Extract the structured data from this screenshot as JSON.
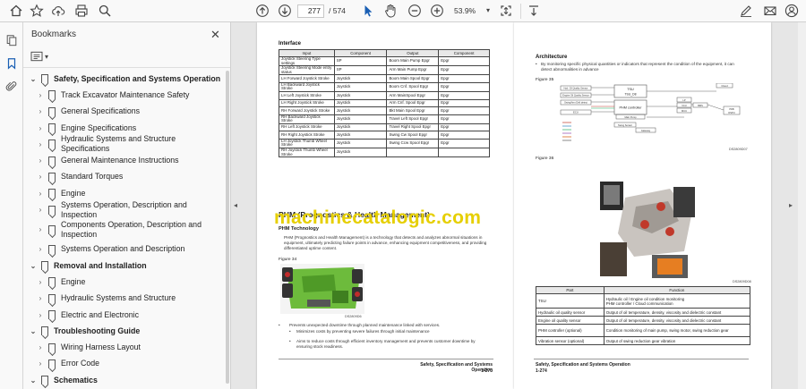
{
  "toolbar": {
    "current_page": "277",
    "total_pages": "/ 574",
    "zoom": "53.9%"
  },
  "bookmarks_panel": {
    "title": "Bookmarks",
    "items": [
      {
        "label": "Safety, Specification and Systems Operation",
        "level": 0,
        "expanded": true
      },
      {
        "label": "Track Excavator Maintenance Safety",
        "level": 1
      },
      {
        "label": "General Specifications",
        "level": 1
      },
      {
        "label": "Engine Specifications",
        "level": 1
      },
      {
        "label": "Hydraulic Systems and Structure Specifications",
        "level": 1
      },
      {
        "label": "General Maintenance Instructions",
        "level": 1
      },
      {
        "label": "Standard Torques",
        "level": 1
      },
      {
        "label": "Engine",
        "level": 1
      },
      {
        "label": "Systems Operation, Description and Inspection",
        "level": 1
      },
      {
        "label": "Components Operation, Description and Inspection",
        "level": 1,
        "two_line": true
      },
      {
        "label": "Systems Operation and Description",
        "level": 1
      },
      {
        "label": "Removal and Installation",
        "level": 0,
        "expanded": true
      },
      {
        "label": "Engine",
        "level": 1
      },
      {
        "label": "Hydraulic Systems and Structure",
        "level": 1
      },
      {
        "label": "Electric and Electronic",
        "level": 1
      },
      {
        "label": "Troubleshooting Guide",
        "level": 0,
        "expanded": true
      },
      {
        "label": "Wiring Harness Layout",
        "level": 1
      },
      {
        "label": "Error Code",
        "level": 1
      },
      {
        "label": "Schematics",
        "level": 0,
        "expanded": true
      }
    ]
  },
  "left_page": {
    "section": "Interface",
    "table_headers": [
      "Input",
      "Component",
      "Output",
      "Component"
    ],
    "table_rows": [
      [
        "Joystick Steering Type settings",
        "SP",
        "Boom Main Pump Epgr",
        "Epgr"
      ],
      [
        "Joystick Steering Mode entry status",
        "SP",
        "Arm Main Pump Epgr",
        "Epgr"
      ],
      [
        "LH Forward Joystick Stroke",
        "Joystick",
        "Boom Main Spool Epgr",
        "Epgr"
      ],
      [
        "LH Backward Joystick Stroke",
        "Joystick",
        "Boom Cnf. Spool Epgr",
        "Epgr"
      ],
      [
        "LH Left Joystick Stroke",
        "Joystick",
        "Arm MainSpool Epgr",
        "Epgr"
      ],
      [
        "LH Right Joystick Stroke",
        "Joystick",
        "Arm Cnf. Spool Epgr",
        "Epgr"
      ],
      [
        "RH Forward Joystick Stroke",
        "Joystick",
        "Bkt Main Spool Epgr",
        "Epgr"
      ],
      [
        "RH Backward Joystick Stroke",
        "Joystick",
        "Travel Left Spool Epgr",
        "Epgr"
      ],
      [
        "RH Left Joystick Stroke",
        "Joystick",
        "Travel Right Spool Epgr",
        "Epgr"
      ],
      [
        "RH Right Joystick Stroke",
        "Joystick",
        "Swing Cw Spool Epgr",
        "Epgr"
      ],
      [
        "LH Joystick Thumb Wheel Stroke",
        "Joystick",
        "Swing Ccw Spool Epgr",
        "Epgr"
      ],
      [
        "RH Joystick Thumb Wheel Stroke",
        "Joystick",
        "",
        ""
      ]
    ],
    "heading": "PHM (Prognostics & Health Management)",
    "subheading": "PHM Technology",
    "para": "PHM (Prognostics and Health Management) is a technology that detects and analyzes abnormal situations in equipment, ultimately predicting failure points in advance, enhancing equipment competitiveness, and providing differentiated uptime content.",
    "figure_label": "Figure 34",
    "figure_id": "DS2809D6",
    "bullet_1": "Prevents unexpected downtime through planned maintenance linked with services.",
    "bullet_2": "Minimizes costs by preventing severe failures through initial maintenance",
    "bullet_3": "Aims to reduce costs through efficient inventory management and prevents customer downtime by ensuring stock readiness.",
    "footer_title": "Safety, Specification and Systems Operation",
    "footer_page": "1-273"
  },
  "right_page": {
    "section": "Architecture",
    "para": "By monitoring specific physical quantities or indicators that represent the condition of the equipment, it can detect abnormalities in advance",
    "figure35_label": "Figure 35",
    "figure35_id": "DS2809D07",
    "diagram": {
      "tsu": "TSU",
      "tsu_d8": "TSU_D8",
      "phm_controller": "PHM controller",
      "cloud": "Cloud",
      "hyd_oil_sensor": "Hyd. Oil Quality Sensor",
      "eng_oil_sensor": "Engine Oil Quality Sensor",
      "swing_vib": "Swing/Arm Drift detect",
      "ecu": "ECU",
      "mcu": "MCU",
      "pump": "Main Pump",
      "swing_sensor": "Swing Sensor",
      "gateway": "Gateway",
      "bms": "BMS",
      "dspu": "DSPU",
      "lp": "LP",
      "vcu": "VCU",
      "pdb": "PDB"
    },
    "figure36_label": "Figure 36",
    "figure36_id": "DS2809D08",
    "parts_headers": [
      "Part",
      "Function"
    ],
    "parts_rows": [
      [
        "TSU",
        "Hydraulic oil / Engine oil condition monitoring\nPHM controller / Cloud communication"
      ],
      [
        "Hydraulic oil quality sensor",
        "Output of oil temperature, density, viscosity and dielectric constant"
      ],
      [
        "Engine oil quality sensor",
        "Output of oil temperature, density, viscosity and dielectric constant"
      ],
      [
        "PHM controller (optional)",
        "Condition monitoring of main pump, swing motor, swing reduction gear"
      ],
      [
        "Vibration sensor (optional)",
        "Output of swing reduction gear vibration"
      ]
    ],
    "footer_title": "Safety, Specification and Systems Operation",
    "footer_page": "1-274"
  },
  "watermark": "machinecatalogic.com",
  "colors": {
    "watermark": "#e6cf00",
    "toolbar_bg": "#f9f9f9",
    "viewer_bg": "#e6e6e6"
  }
}
